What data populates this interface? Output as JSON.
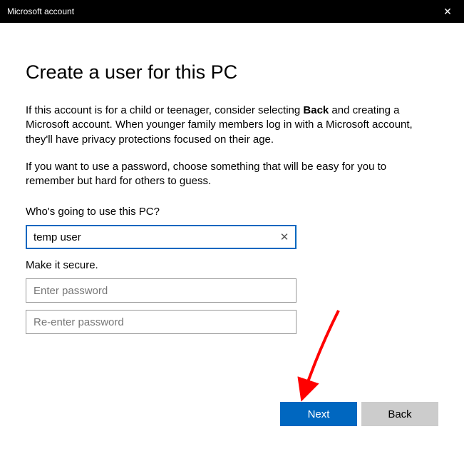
{
  "window": {
    "title": "Microsoft account"
  },
  "page": {
    "heading": "Create a user for this PC",
    "intro_prefix": "If this account is for a child or teenager, consider selecting ",
    "intro_bold": "Back",
    "intro_suffix": " and creating a Microsoft account. When younger family members log in with a Microsoft account, they'll have privacy protections focused on their age.",
    "password_hint": "If you want to use a password, choose something that will be easy for you to remember but hard for others to guess."
  },
  "form": {
    "username_label": "Who's going to use this PC?",
    "username_value": "temp user",
    "secure_label": "Make it secure.",
    "password_placeholder": "Enter password",
    "confirm_placeholder": "Re-enter password"
  },
  "buttons": {
    "next": "Next",
    "back": "Back"
  }
}
